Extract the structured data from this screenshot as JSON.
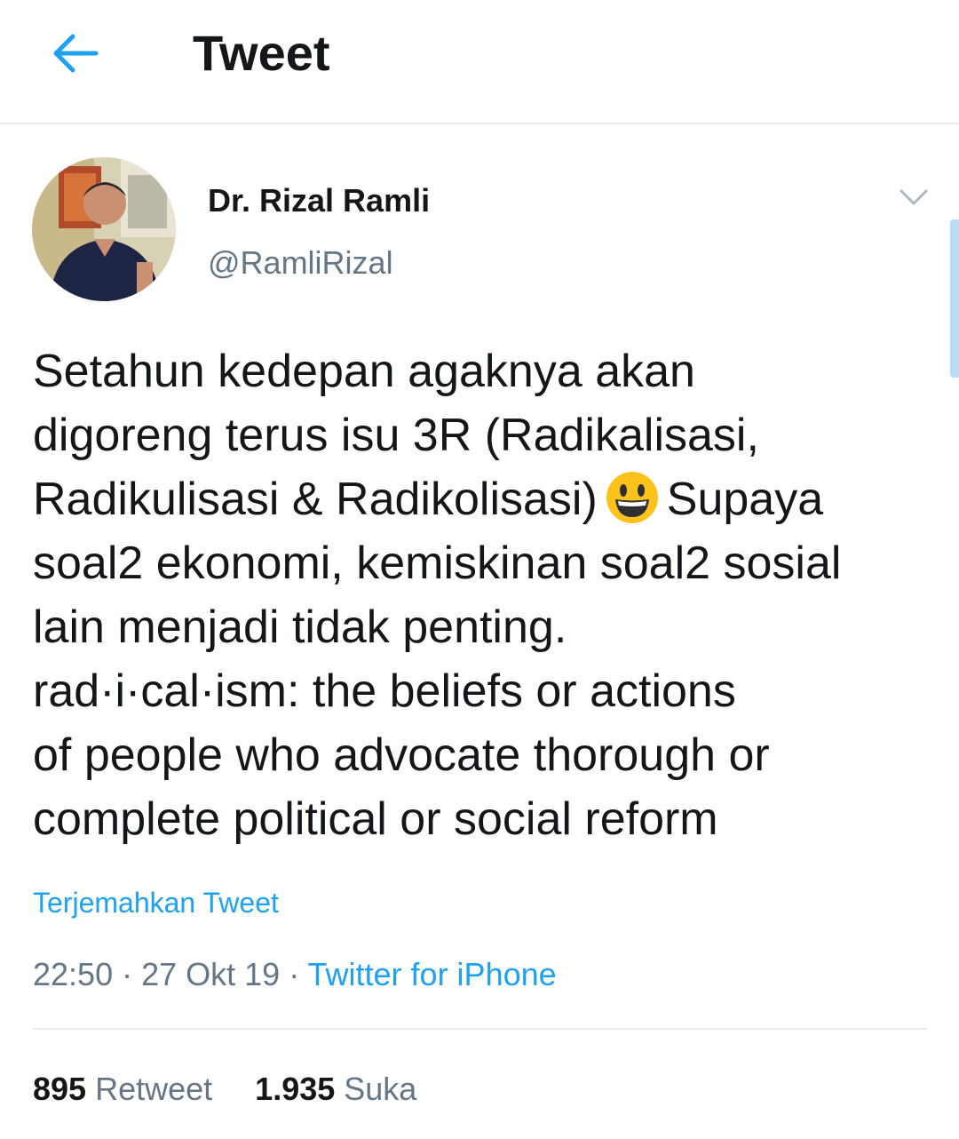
{
  "header": {
    "title": "Tweet",
    "back_icon": "arrow-left-icon",
    "accent_color": "#1da1f2"
  },
  "author": {
    "name": "Dr. Rizal Ramli",
    "handle": "@RamliRizal",
    "avatar_icon": "avatar-photo",
    "menu_icon": "chevron-down-icon"
  },
  "tweet": {
    "lines": [
      "Setahun kedepan agaknya akan",
      "digoreng terus isu 3R (Radikalisasi,",
      "Radikulisasi & Radikolisasi)",
      "Supaya",
      "soal2 ekonomi, kemiskinan soal2 sosial",
      "lain menjadi tidak penting.",
      "rad·i·cal·ism: the beliefs or actions",
      "of people who advocate thorough or",
      "complete political or social reform"
    ],
    "emoji": "grinning-face-emoji"
  },
  "translate": {
    "label": "Terjemahkan Tweet"
  },
  "meta": {
    "time": "22:50",
    "separator": " · ",
    "date": "27 Okt 19",
    "source": "Twitter for iPhone"
  },
  "stats": {
    "retweets_count": "895",
    "retweets_label": "Retweet",
    "likes_count": "1.935",
    "likes_label": "Suka"
  }
}
